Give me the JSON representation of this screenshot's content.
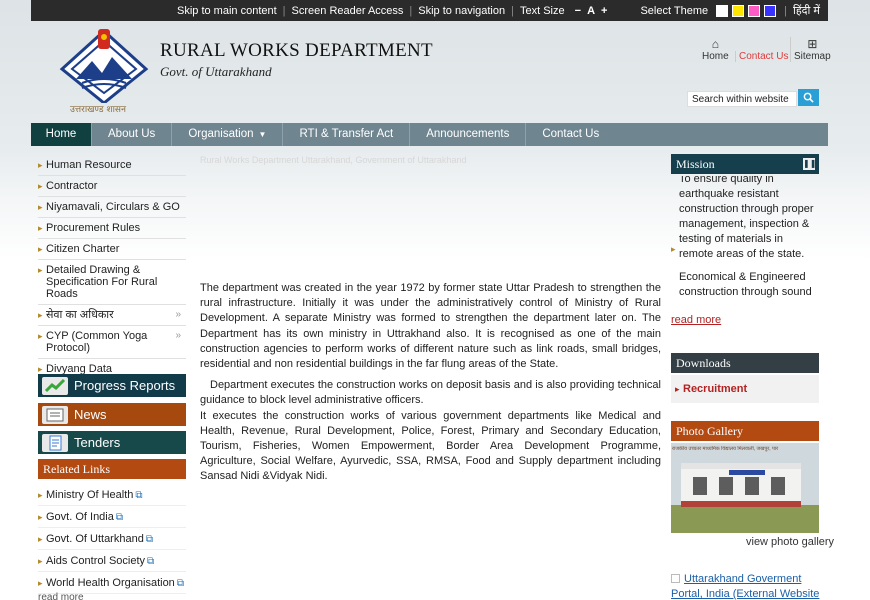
{
  "topbar": {
    "skip_main": "Skip to main content",
    "screen_reader": "Screen Reader Access",
    "skip_nav": "Skip to navigation",
    "text_size": "Text Size",
    "decrease": "−",
    "normal": "A",
    "increase": "+",
    "select_theme": "Select Theme",
    "theme_colors": [
      "#ffffff",
      "#ffe600",
      "#ff5cc5",
      "#3a33ff"
    ],
    "hindi": "हिंदी में"
  },
  "header": {
    "logo_caption": "उत्तराखण्ड शासन",
    "title": "RURAL WORKS DEPARTMENT",
    "subtitle": "Govt. of Uttarakhand",
    "home": "Home",
    "contact": "Contact Us",
    "sitemap": "Sitemap",
    "search_placeholder": "Search within website",
    "search_icon": "search-icon"
  },
  "nav": {
    "items": [
      "Home",
      "About Us",
      "Organisation",
      "RTI & Transfer Act",
      "Announcements",
      "Contact Us"
    ]
  },
  "sidebar": {
    "items": [
      "Human Resource",
      "Contractor",
      "Niyamavali, Circulars & GO",
      "Procurement Rules",
      "Citizen Charter",
      "Detailed Drawing & Specification For Rural Roads",
      "सेवा का अधिकार",
      "CYP (Common Yoga Protocol)",
      "Divyang Data"
    ],
    "progress_reports": "Progress Reports",
    "news": "News",
    "tenders": "Tenders",
    "related_links_title": "Related Links",
    "related_links": [
      "Ministry Of Health",
      "Govt. Of India",
      "Govt. Of Uttarkhand",
      "Aids Control Society",
      "World Health Organisation"
    ],
    "read_more": "read more"
  },
  "main": {
    "banner_alt": "Rural Works Department Uttarakhand, Government of Uttarakhand",
    "para1": "The department was created in the year 1972 by former state Uttar Pradesh to strengthen the rural infrastructure. Initially it was under the administratively control of Ministry of Rural Development. A separate Ministry was formed to strengthen the department later on. The Department has its own ministry in Uttrakhand also. It  is recognised as one of the main construction agencies to perform works of different nature such as link roads, small bridges, residential and non residential buildings in the far flung areas of the State.",
    "para2": "Department executes the construction works on deposit basis and is also providing technical guidance to block level administrative officers.",
    "para3": "It executes the construction works of various government departments like Medical and Health, Revenue, Rural Development, Police, Forest, Primary and Secondary Education, Tourism, Fisheries, Women Empowerment, Border Area Development Programme, Agriculture, Social Welfare, Ayurvedic, SSA, RMSA, Food and Supply department including Sansad Nidi &Vidyak Nidi."
  },
  "right": {
    "mission_title": "Mission",
    "mission_items": [
      "To ensure quality in earthquake resistant construction through proper management, inspection & testing of materials in remote areas of the state.",
      "Economical & Engineered construction through sound planning and design"
    ],
    "read_more": "read more",
    "downloads_title": "Downloads",
    "recruitment": "Recruitment",
    "photo_gallery_title": "Photo Gallery",
    "photo_sign": "राजकीय उच्चतर माध्यमिक विद्यालय मिलवाली, जखपुर, पार",
    "view_gallery": "view photo gallery",
    "portal_link": "Uttarakhand Goverment Portal, India (External Website"
  }
}
